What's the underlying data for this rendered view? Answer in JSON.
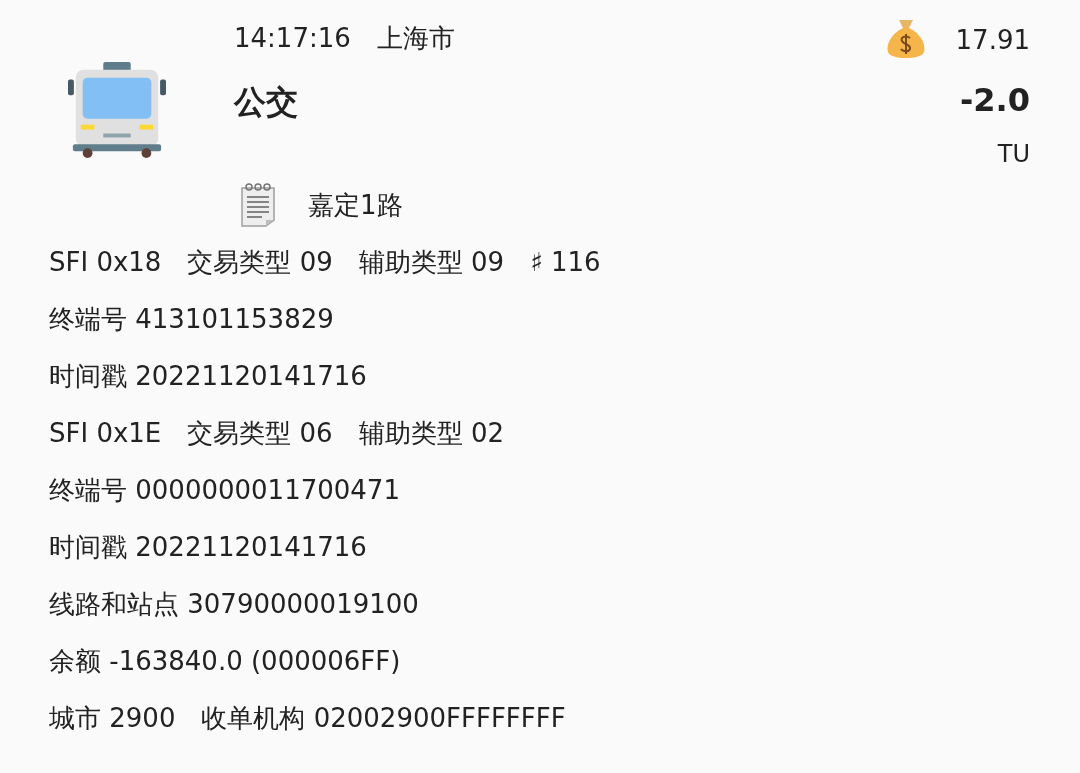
{
  "header": {
    "time": "14:17:16",
    "city": "上海市",
    "title": "公交",
    "balance": "17.91",
    "amount": "-2.0",
    "unit": "TU"
  },
  "note": {
    "text": "嘉定1路"
  },
  "details": [
    {
      "parts": [
        "SFI 0x18",
        "交易类型 09",
        "辅助类型 09",
        "♯ 116"
      ]
    },
    {
      "parts": [
        "终端号 413101153829"
      ]
    },
    {
      "parts": [
        "时间戳 20221120141716"
      ]
    },
    {
      "parts": [
        "SFI 0x1E",
        "交易类型 06",
        "辅助类型 02"
      ]
    },
    {
      "parts": [
        "终端号 0000000011700471"
      ]
    },
    {
      "parts": [
        "时间戳 20221120141716"
      ]
    },
    {
      "parts": [
        "线路和站点 30790000019100"
      ]
    },
    {
      "parts": [
        "余额 -163840.0 (000006FF)"
      ]
    },
    {
      "parts": [
        "城市 2900",
        "收单机构 02002900FFFFFFFF"
      ]
    }
  ]
}
